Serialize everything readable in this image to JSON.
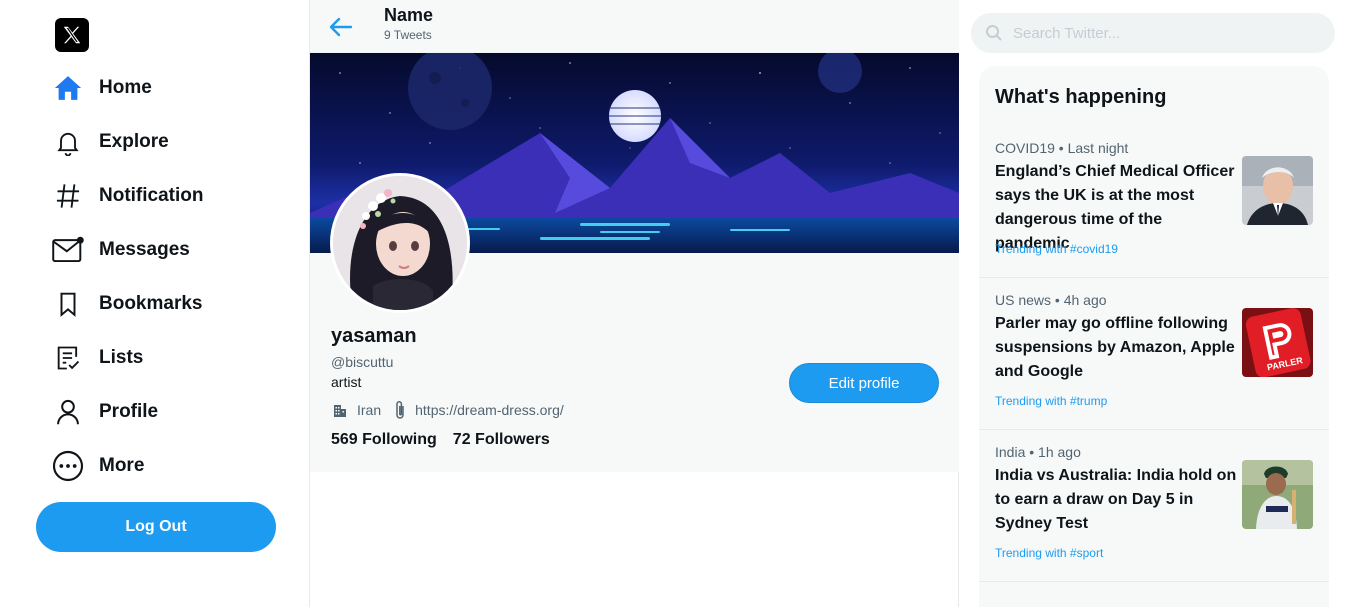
{
  "sidebar": {
    "logo": "x-logo-icon",
    "items": [
      {
        "label": "Home",
        "icon": "home-icon"
      },
      {
        "label": "Explore",
        "icon": "bell-icon"
      },
      {
        "label": "Notification",
        "icon": "hashtag-icon"
      },
      {
        "label": "Messages",
        "icon": "mail-icon"
      },
      {
        "label": "Bookmarks",
        "icon": "bookmark-icon"
      },
      {
        "label": "Lists",
        "icon": "list-icon"
      },
      {
        "label": "Profile",
        "icon": "user-icon"
      },
      {
        "label": "More",
        "icon": "more-icon"
      }
    ],
    "logout_label": "Log Out"
  },
  "header": {
    "name": "Name",
    "tweet_count": "9 Tweets"
  },
  "profile": {
    "display_name": "yasaman",
    "handle": "@biscuttu",
    "bio": "artist",
    "location": "Iran",
    "website": "https://dream-dress.org/",
    "following": "569 Following",
    "followers": "72 Followers",
    "edit_label": "Edit profile"
  },
  "search": {
    "placeholder": "Search Twitter..."
  },
  "trends": {
    "title": "What's happening",
    "items": [
      {
        "category": "COVID19 • Last night",
        "headline": "England’s Chief Medical Officer says the UK is at the most dangerous time of the pandemic",
        "footer": "Trending with #covid19",
        "image": "news-photo-man"
      },
      {
        "category": "US news • 4h ago",
        "headline": "Parler may go offline following suspensions by Amazon, Apple and Google",
        "footer": "Trending with #trump",
        "image": "parler-logo-photo"
      },
      {
        "category": "India • 1h ago",
        "headline": "India vs Australia: India hold on to earn a draw on Day 5 in Sydney Test",
        "footer": "Trending with #sport",
        "image": "cricket-player-photo"
      }
    ]
  },
  "colors": {
    "accent": "#1d9bf0",
    "home_icon": "#1d7af0",
    "panel_bg": "#f7f9f9"
  }
}
